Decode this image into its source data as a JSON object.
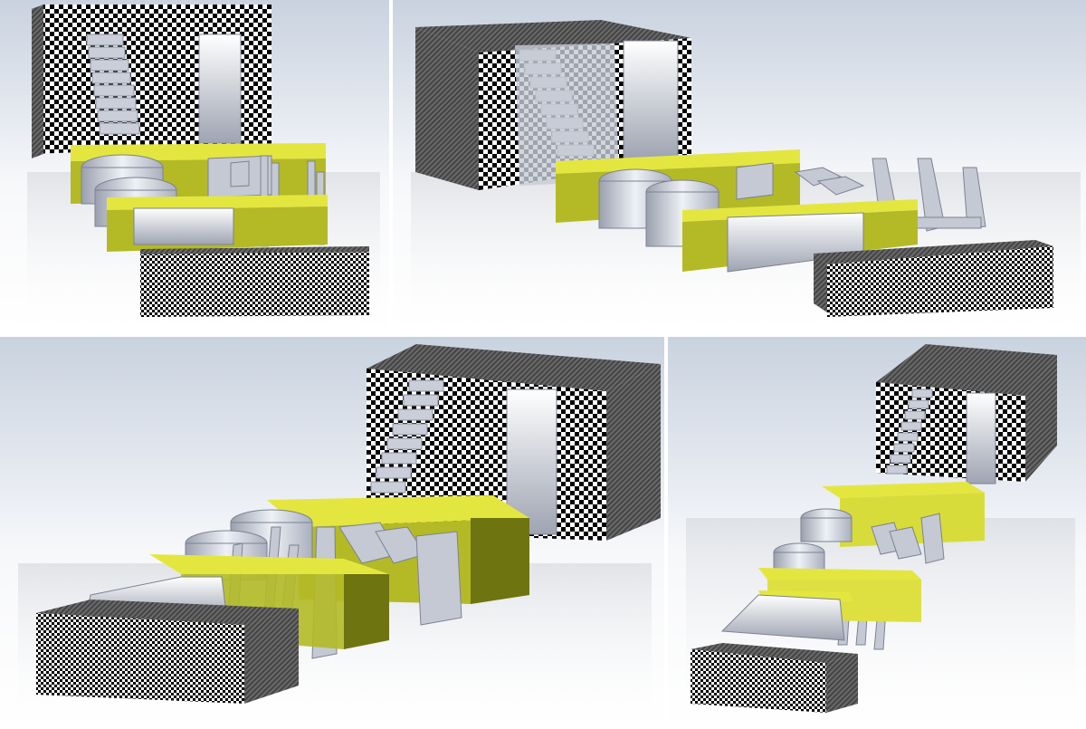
{
  "views": [
    {
      "id": "view-front-left"
    },
    {
      "id": "view-front-right"
    },
    {
      "id": "view-low-right"
    },
    {
      "id": "view-top-right"
    }
  ],
  "colors": {
    "yellow_top": "#e8ea45",
    "yellow_front": "#b7bd2a",
    "yellow_side": "#6e7410",
    "metal_light": "#dfe3ec",
    "metal_mid": "#b2b8c6",
    "metal_dark": "#7c8292",
    "checker_a": "#000000",
    "checker_b": "#ffffff"
  }
}
